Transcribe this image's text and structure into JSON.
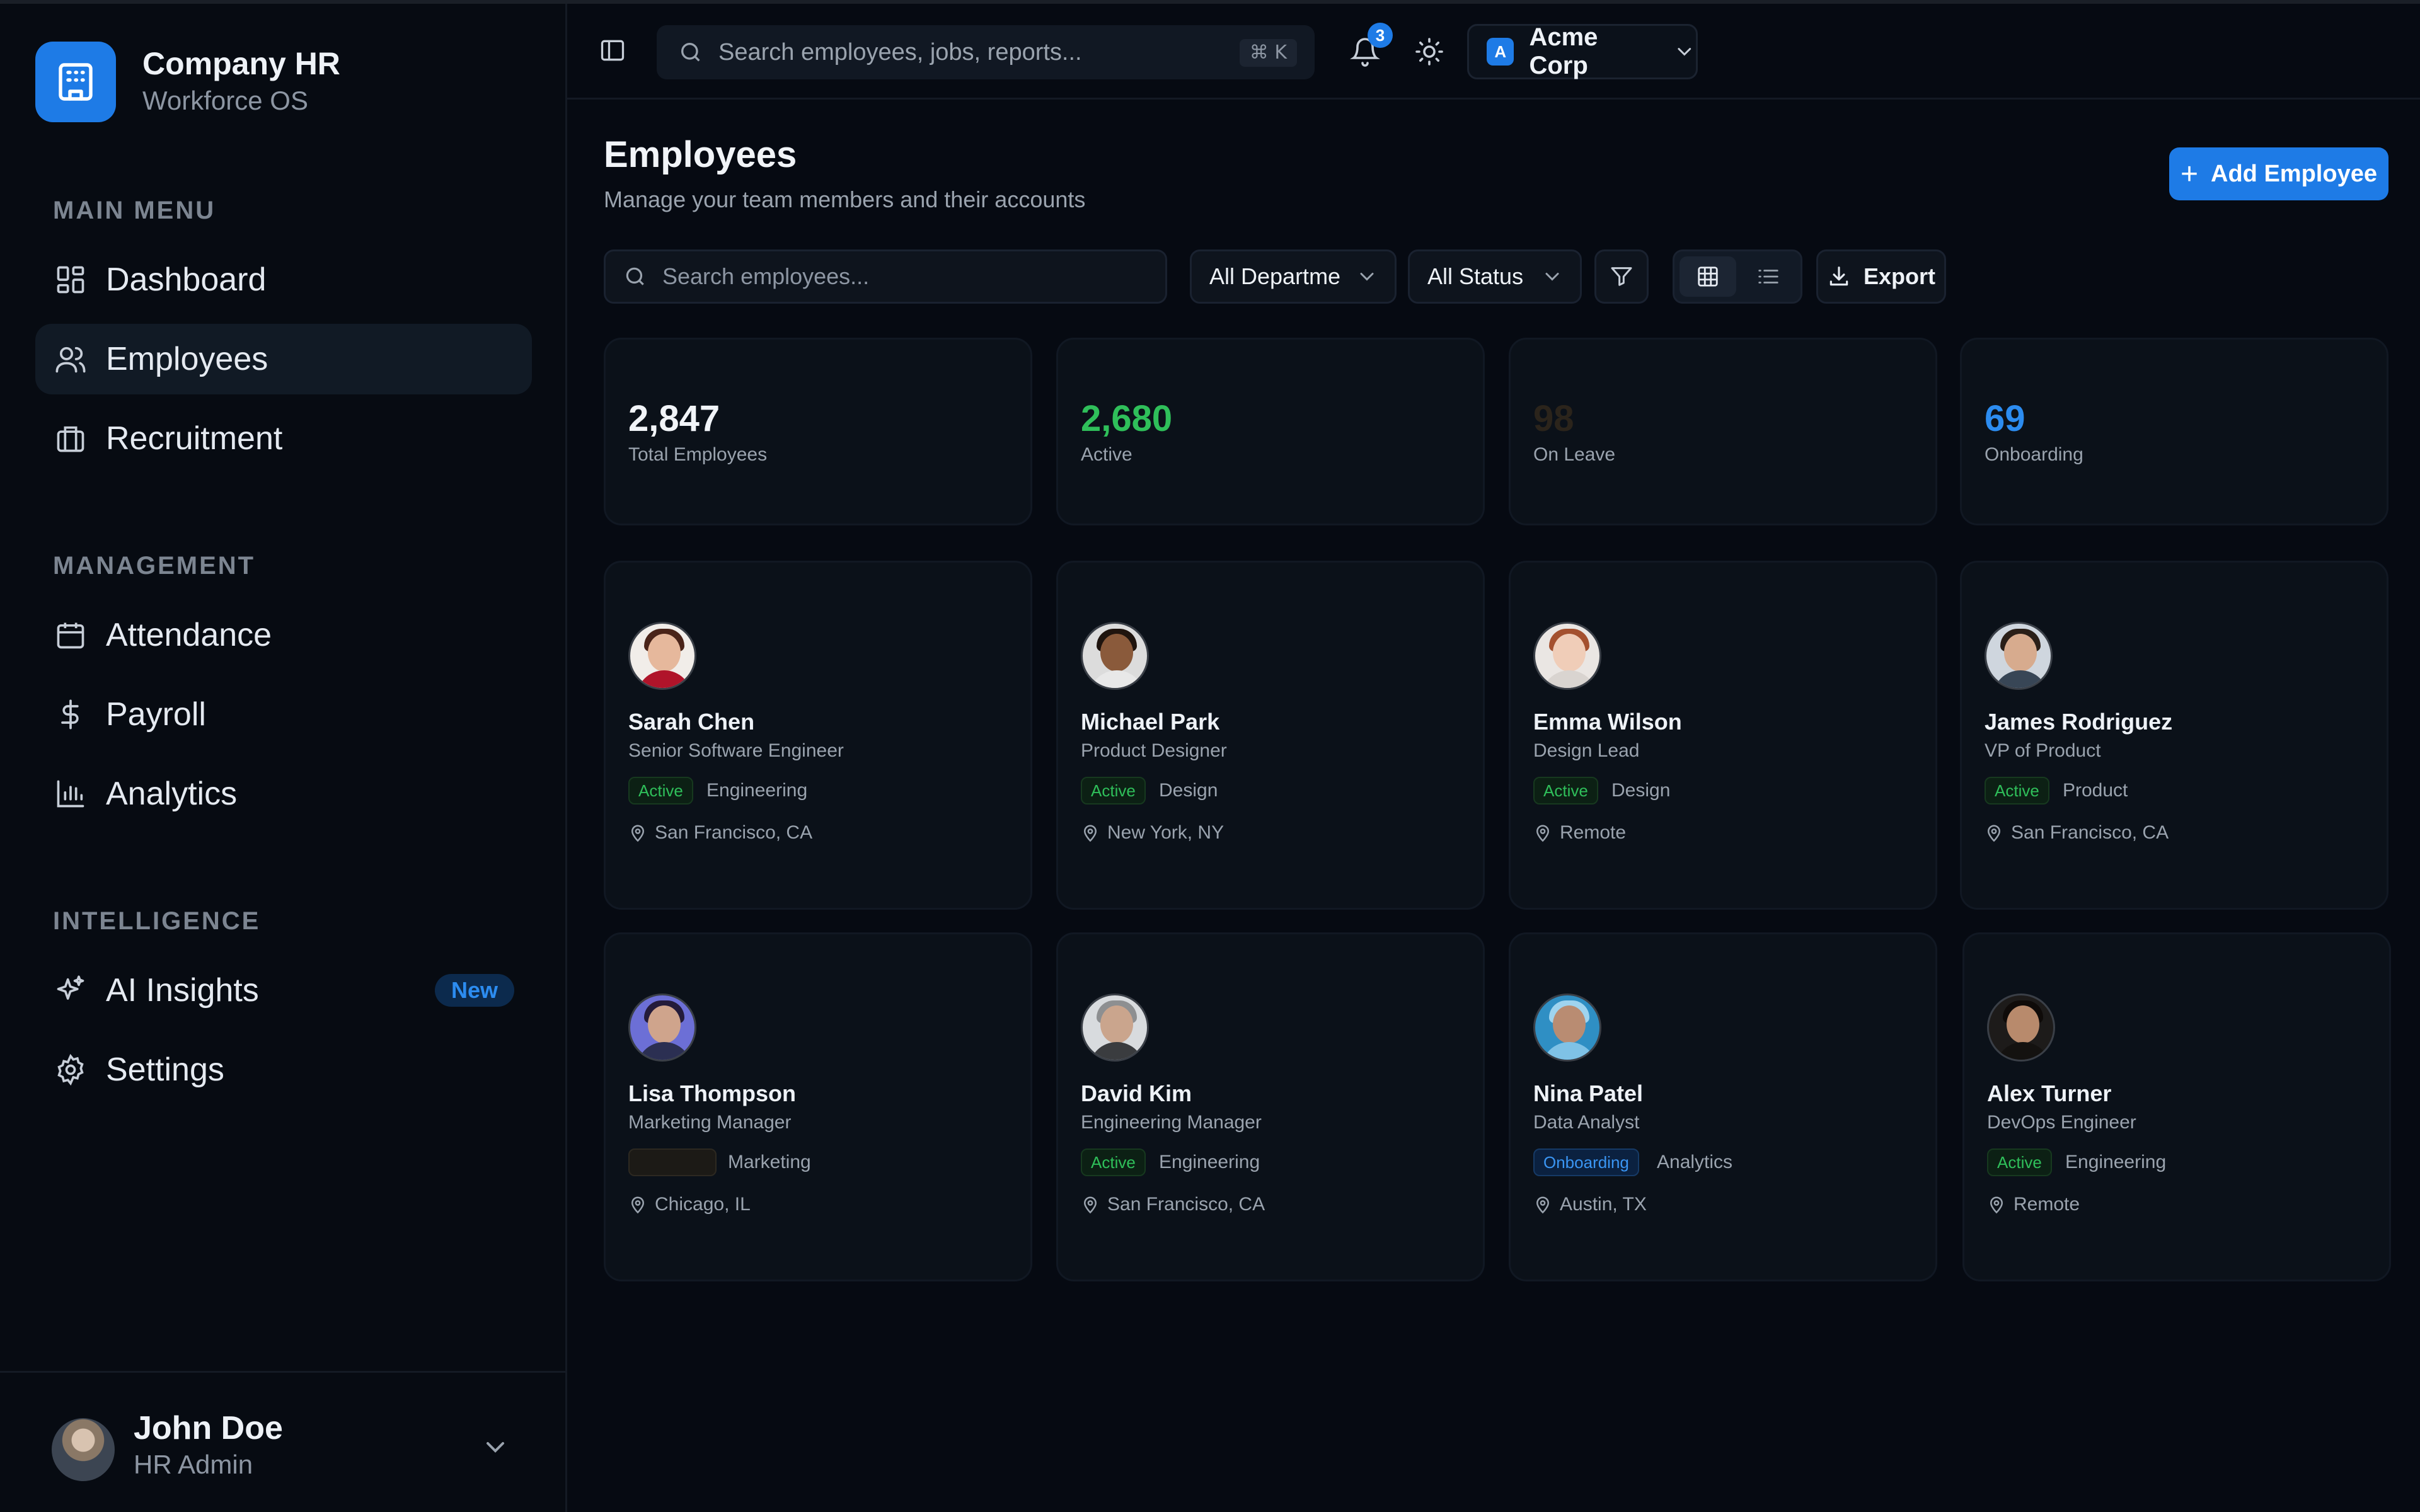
{
  "app": {
    "title": "Company HR",
    "subtitle": "Workforce OS"
  },
  "sidebar": {
    "sections": [
      {
        "title": "MAIN MENU"
      },
      {
        "title": "MANAGEMENT"
      },
      {
        "title": "INTELLIGENCE"
      }
    ],
    "items": [
      {
        "label": "Dashboard",
        "icon": "dashboard-icon"
      },
      {
        "label": "Employees",
        "icon": "users-icon",
        "active": true
      },
      {
        "label": "Recruitment",
        "icon": "briefcase-icon"
      },
      {
        "label": "Attendance",
        "icon": "calendar-icon"
      },
      {
        "label": "Payroll",
        "icon": "dollar-icon"
      },
      {
        "label": "Analytics",
        "icon": "bar-chart-icon"
      },
      {
        "label": "AI Insights",
        "icon": "sparkles-icon",
        "badge": "New"
      },
      {
        "label": "Settings",
        "icon": "gear-icon"
      }
    ],
    "user": {
      "name": "John Doe",
      "role": "HR Admin"
    }
  },
  "topbar": {
    "search_placeholder": "Search employees, jobs, reports...",
    "shortcut": "⌘ K",
    "notification_count": "3",
    "org": {
      "initial": "A",
      "name": "Acme Corp"
    }
  },
  "page": {
    "title": "Employees",
    "subtitle": "Manage your team members and their accounts",
    "add_button": "Add Employee"
  },
  "filters": {
    "search_placeholder": "Search employees...",
    "department": "All Departme",
    "status": "All Status",
    "export_label": "Export"
  },
  "stats": [
    {
      "value": "2,847",
      "label": "Total Employees",
      "color": "#f1f4f8"
    },
    {
      "value": "2,680",
      "label": "Active",
      "color": "#2fbf5a"
    },
    {
      "value": "98",
      "label": "On Leave",
      "color": "#2b241b"
    },
    {
      "value": "69",
      "label": "Onboarding",
      "color": "#2c8cf0"
    }
  ],
  "employees": [
    {
      "name": "Sarah Chen",
      "title": "Senior Software Engineer",
      "status": "Active",
      "department": "Engineering",
      "location": "San Francisco, CA"
    },
    {
      "name": "Michael Park",
      "title": "Product Designer",
      "status": "Active",
      "department": "Design",
      "location": "New York, NY"
    },
    {
      "name": "Emma Wilson",
      "title": "Design Lead",
      "status": "Active",
      "department": "Design",
      "location": "Remote"
    },
    {
      "name": "James Rodriguez",
      "title": "VP of Product",
      "status": "Active",
      "department": "Product",
      "location": "San Francisco, CA"
    },
    {
      "name": "Lisa Thompson",
      "title": "Marketing Manager",
      "status": "",
      "department": "Marketing",
      "location": "Chicago, IL"
    },
    {
      "name": "David Kim",
      "title": "Engineering Manager",
      "status": "Active",
      "department": "Engineering",
      "location": "San Francisco, CA"
    },
    {
      "name": "Nina Patel",
      "title": "Data Analyst",
      "status": "Onboarding",
      "department": "Analytics",
      "location": "Austin, TX"
    },
    {
      "name": "Alex Turner",
      "title": "DevOps Engineer",
      "status": "Active",
      "department": "Engineering",
      "location": "Remote"
    }
  ],
  "colors": {
    "accent": "#1e7be6",
    "active": "#2fbf5a",
    "onboarding": "#2c8cf0",
    "background": "#060a12"
  }
}
